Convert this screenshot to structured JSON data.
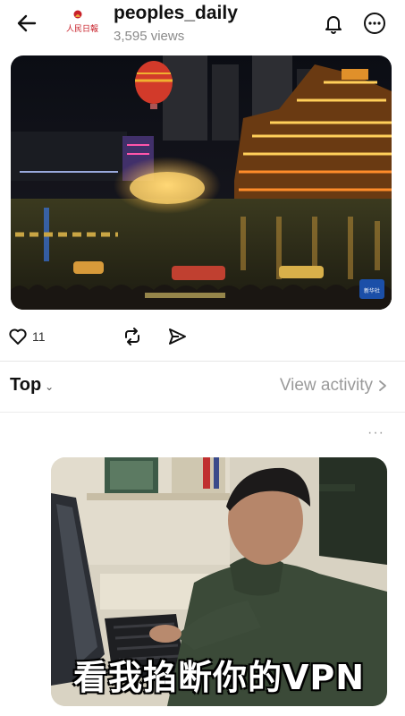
{
  "header": {
    "title": "peoples_daily",
    "views": "3,595 views",
    "avatar_text": "人民日報",
    "brand_color": "#c8202a"
  },
  "post": {
    "image_description_icon": "night-riverside-festival-photo",
    "watermark": "新华社",
    "like_count": "11"
  },
  "replies_bar": {
    "sort_label": "Top",
    "activity_label": "View activity"
  },
  "reply": {
    "more_label": "···",
    "caption": "看我掐断你的VPN"
  }
}
